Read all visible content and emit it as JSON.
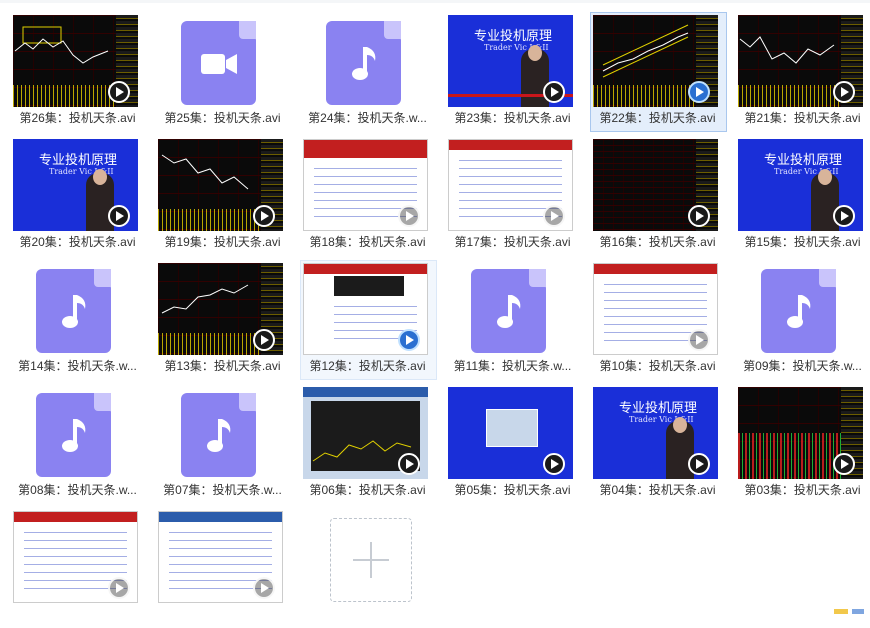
{
  "files": [
    {
      "label": "第26集：投机天条.avi"
    },
    {
      "label": "第25集：投机天条.avi"
    },
    {
      "label": "第24集：投机天条.w..."
    },
    {
      "label": "第23集：投机天条.avi"
    },
    {
      "label": "第22集：投机天条.avi"
    },
    {
      "label": "第21集：投机天条.avi"
    },
    {
      "label": "第20集：投机天条.avi"
    },
    {
      "label": "第19集：投机天条.avi"
    },
    {
      "label": "第18集：投机天条.avi"
    },
    {
      "label": "第17集：投机天条.avi"
    },
    {
      "label": "第16集：投机天条.avi"
    },
    {
      "label": "第15集：投机天条.avi"
    },
    {
      "label": "第14集：投机天条.w..."
    },
    {
      "label": "第13集：投机天条.avi"
    },
    {
      "label": "第12集：投机天条.avi"
    },
    {
      "label": "第11集：投机天条.w..."
    },
    {
      "label": "第10集：投机天条.avi"
    },
    {
      "label": "第09集：投机天条.w..."
    },
    {
      "label": "第08集：投机天条.w..."
    },
    {
      "label": "第07集：投机天条.w..."
    },
    {
      "label": "第06集：投机天条.avi"
    },
    {
      "label": "第05集：投机天条.avi"
    },
    {
      "label": "第04集：投机天条.avi"
    },
    {
      "label": "第03集：投机天条.avi"
    }
  ],
  "book_cover": {
    "title": "专业投机原理",
    "subtitle": "Trader Vic I &II"
  },
  "colors": {
    "icon_purple": "#8a82f1",
    "selection": "#e4eefb"
  }
}
